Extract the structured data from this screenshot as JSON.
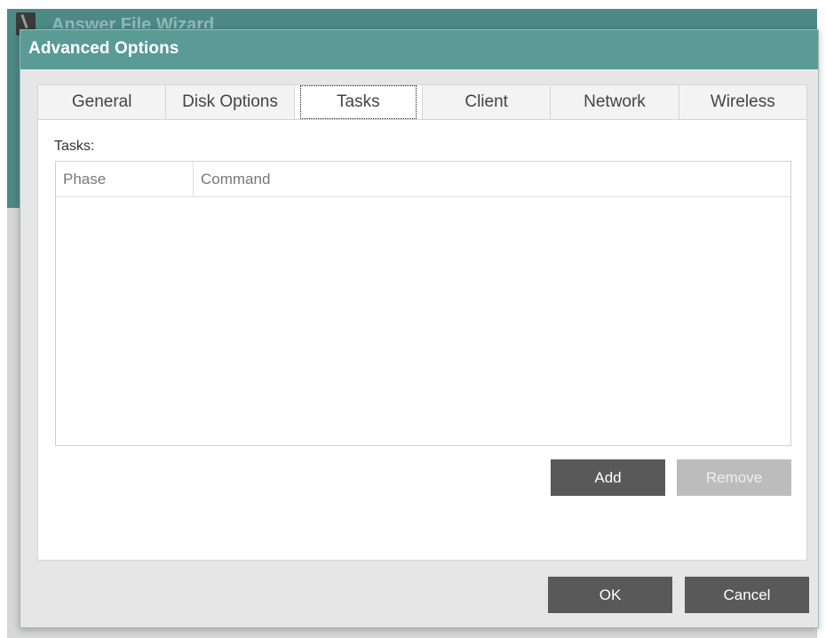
{
  "background_window": {
    "title": "Answer File Wizard"
  },
  "dialog": {
    "title": "Advanced Options"
  },
  "tabs": [
    {
      "label": "General"
    },
    {
      "label": "Disk Options"
    },
    {
      "label": "Tasks",
      "active": true
    },
    {
      "label": "Client"
    },
    {
      "label": "Network"
    },
    {
      "label": "Wireless"
    }
  ],
  "tasks_panel": {
    "label": "Tasks:",
    "columns": [
      "Phase",
      "Command"
    ],
    "rows": [],
    "add_label": "Add",
    "remove_label": "Remove"
  },
  "footer": {
    "ok_label": "OK",
    "cancel_label": "Cancel"
  },
  "colors": {
    "accent": "#5a9b96",
    "dark_button": "#595959",
    "disabled_button": "#bcbcbc"
  }
}
